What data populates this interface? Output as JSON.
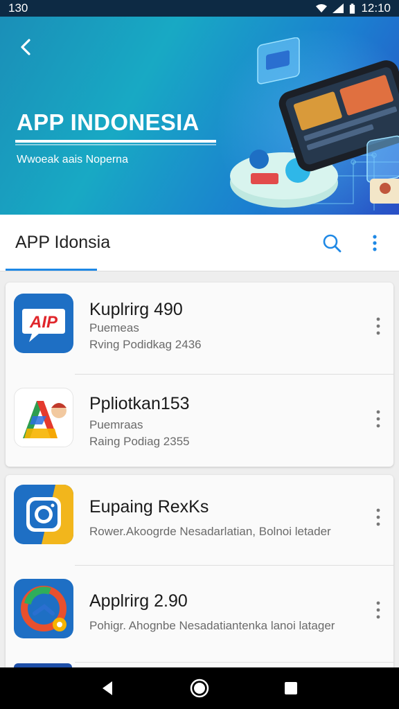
{
  "status_bar": {
    "left_text": "130",
    "time": "12:10"
  },
  "hero": {
    "title": "APP INDONESIA",
    "subtitle": "Wwoeak aais Noperna",
    "colors": {
      "start": "#1a8fb8",
      "end": "#2a4fc6"
    }
  },
  "toolbar": {
    "title": "APP Idonsia",
    "accent": "#1e88e5"
  },
  "apps": [
    {
      "name": "Kuplrirg 490",
      "line1": "Puemeas",
      "line2": "Rving Podidkag 2436",
      "icon": "aip-chat-icon",
      "icon_color": "#1e6fc4"
    },
    {
      "name": "Ppliotkan153",
      "line1": "Puemraas",
      "line2": "Raing Podiag 2355",
      "icon": "colorful-a-icon",
      "icon_color": "#ffffff"
    },
    {
      "name": "Eupaing RexKs",
      "line1": "Rower.Akoogrde Nesadarlatian, Bolnoi letader",
      "icon": "camera-icon",
      "icon_color": "#1e6fc4"
    },
    {
      "name": "Applrirg 2.90",
      "line1": "Pohigr. Ahognbe Nesadatiantenka lanoi latager",
      "icon": "circle-logo-icon",
      "icon_color": "#1e6fc4"
    }
  ]
}
